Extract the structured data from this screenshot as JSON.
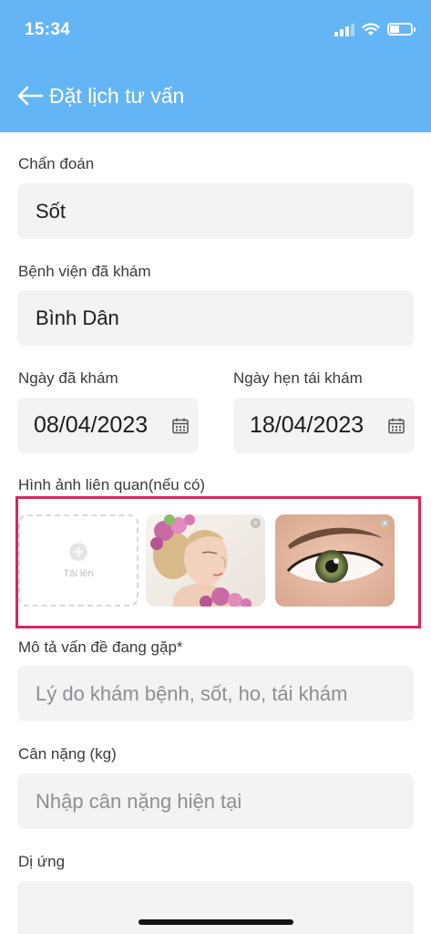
{
  "status_bar": {
    "time": "15:34"
  },
  "header": {
    "title": "Đặt lịch tư vấn",
    "back_icon": "arrow-left-icon"
  },
  "form": {
    "diagnosis": {
      "label": "Chẩn đoán",
      "value": "Sốt"
    },
    "hospital": {
      "label": "Bệnh viện đã khám",
      "value": "Bình Dân"
    },
    "exam_date": {
      "label": "Ngày đã khám",
      "value": "08/04/2023"
    },
    "followup_date": {
      "label": "Ngày hẹn tái khám",
      "value": "18/04/2023"
    },
    "images": {
      "label": "Hình ảnh liên quan(nếu có)",
      "upload_label": "Tải lên"
    },
    "description": {
      "label": "Mô tả vấn đề đang gặp*",
      "placeholder": "Lý do khám bệnh, sốt, ho, tái khám"
    },
    "weight": {
      "label": "Cân nặng (kg)",
      "placeholder": "Nhập cân nặng hiện tại"
    },
    "allergy": {
      "label": "Dị ứng"
    }
  },
  "colors": {
    "header": "#64b5f6",
    "highlight": "#d6285e",
    "field_bg": "#f2f3f5"
  }
}
